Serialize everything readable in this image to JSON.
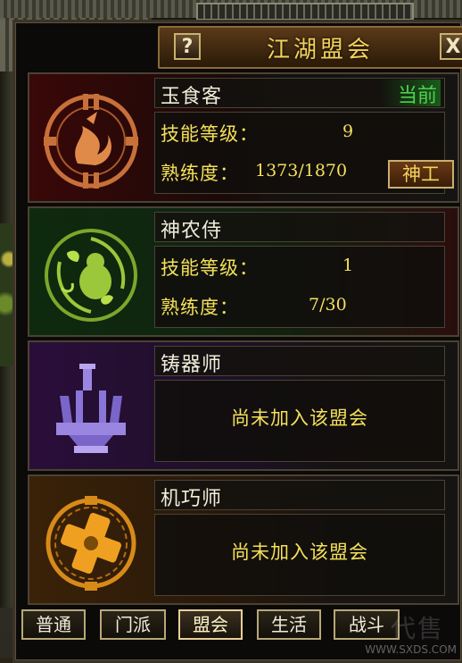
{
  "window": {
    "title": "江湖盟会",
    "help_label": "?",
    "close_label": "X"
  },
  "guilds": [
    {
      "name": "玉食客",
      "status": "当前",
      "skill_level_label": "技能等级：",
      "skill_level": "9",
      "proficiency_label": "熟练度：",
      "proficiency": "1373/1870",
      "action_label": "神工",
      "emblem": "dragon-ring-emblem",
      "accent": "#c8703a"
    },
    {
      "name": "神农侍",
      "skill_level_label": "技能等级：",
      "skill_level": "1",
      "proficiency_label": "熟练度：",
      "proficiency": "7/30",
      "emblem": "gourd-vine-emblem",
      "accent": "#9ac83a"
    },
    {
      "name": "铸器师",
      "not_joined_text": "尚未加入该盟会",
      "emblem": "forge-anvil-emblem",
      "accent": "#8a70d8"
    },
    {
      "name": "机巧师",
      "not_joined_text": "尚未加入该盟会",
      "emblem": "gear-cross-emblem",
      "accent": "#f0a020"
    }
  ],
  "tabs": [
    {
      "label": "普通"
    },
    {
      "label": "门派"
    },
    {
      "label": "盟会",
      "active": true
    },
    {
      "label": "生活"
    },
    {
      "label": "战斗"
    }
  ],
  "watermark": {
    "big": "代售",
    "site": "WWW.SXDS.COM"
  }
}
